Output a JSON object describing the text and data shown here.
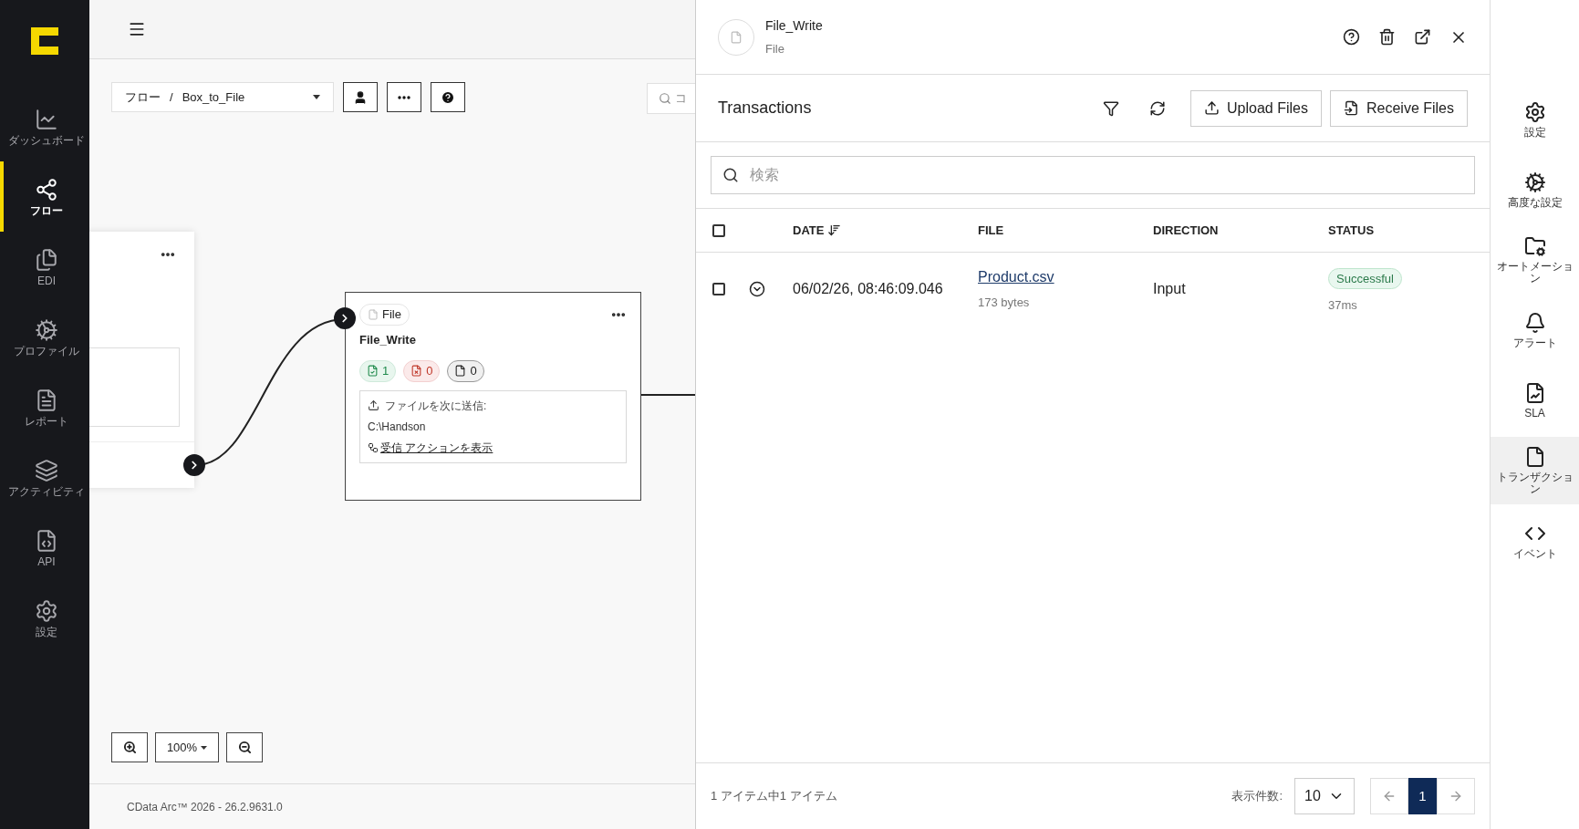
{
  "sidebar": {
    "items": [
      {
        "label": "ダッシュボード",
        "selected": false
      },
      {
        "label": "フロー",
        "selected": true
      },
      {
        "label": "EDI",
        "selected": false
      },
      {
        "label": "プロファイル",
        "selected": false
      },
      {
        "label": "レポート",
        "selected": false
      },
      {
        "label": "アクティビティ",
        "selected": false
      },
      {
        "label": "API",
        "selected": false
      },
      {
        "label": "設定",
        "selected": false
      }
    ]
  },
  "canvas": {
    "breadcrumb": {
      "root": "フロー",
      "separator": "/",
      "flow": "Box_to_File"
    },
    "search": {
      "placeholder": "コ"
    },
    "node": {
      "tag": "File",
      "title": "File_Write",
      "counters": [
        {
          "kind": "success",
          "count": "1"
        },
        {
          "kind": "error",
          "count": "0"
        },
        {
          "kind": "pending",
          "count": "0"
        }
      ],
      "info_label": "ファイルを次に送信:",
      "path": "C:\\Handson",
      "link": "受信 アクションを表示"
    },
    "zoom": "100%",
    "footer": "CData Arc™ 2026 - 26.2.9631.0"
  },
  "panel": {
    "title": "File_Write",
    "subtitle": "File",
    "section": "Transactions",
    "buttons": [
      {
        "kind": "upload",
        "label": "Upload Files"
      },
      {
        "kind": "receive",
        "label": "Receive Files"
      }
    ],
    "search": {
      "placeholder": "検索"
    },
    "table": {
      "all_checked": false,
      "columns": [
        {
          "label": "DATE",
          "sorted": true
        },
        {
          "label": "FILE",
          "sorted": false
        },
        {
          "label": "DIRECTION",
          "sorted": false
        },
        {
          "label": "STATUS",
          "sorted": false
        }
      ],
      "rows": [
        {
          "checked": false,
          "date": "06/02/26, 08:46:09.046",
          "file": "Product.csv",
          "size": "173 bytes",
          "direction": "Input",
          "status": "Successful",
          "duration": "37ms"
        }
      ]
    },
    "footer": {
      "summary": "1 アイテム中1 アイテム",
      "page_size_label": "表示件数:",
      "page_size": "10",
      "pages": [
        {
          "label": "1",
          "selected": true
        }
      ]
    }
  },
  "right_sidebar": {
    "items": [
      {
        "label": "設定",
        "selected": false
      },
      {
        "label": "高度な設定",
        "selected": false
      },
      {
        "label": "オートメーション",
        "selected": false
      },
      {
        "label": "アラート",
        "selected": false
      },
      {
        "label": "SLA",
        "selected": false
      },
      {
        "label": "トランザクション",
        "selected": true
      },
      {
        "label": "イベント",
        "selected": false
      }
    ]
  }
}
